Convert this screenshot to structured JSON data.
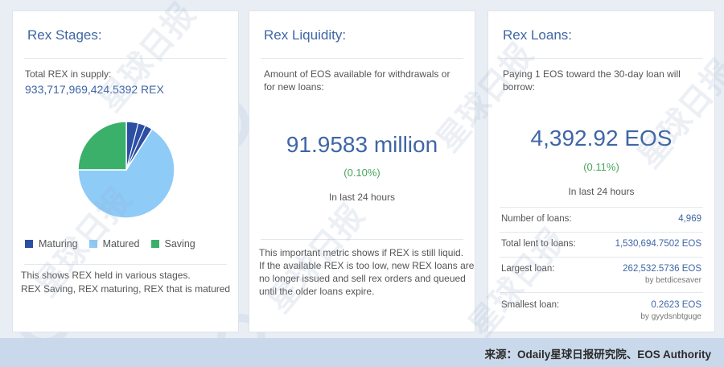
{
  "panels": {
    "stages": {
      "title": "Rex Stages:",
      "supply_label": "Total REX in supply:",
      "supply_value": "933,717,969,424.5392 REX",
      "legend": [
        {
          "label": "Maturing",
          "color": "#2d4fa3"
        },
        {
          "label": "Matured",
          "color": "#8ecbf7"
        },
        {
          "label": "Saving",
          "color": "#3ab06a"
        }
      ],
      "description_line1": "This shows REX held in various stages.",
      "description_line2": "REX Saving, REX maturing, REX that is matured"
    },
    "liquidity": {
      "title": "Rex Liquidity:",
      "description_line1": "Amount of EOS available for withdrawals or",
      "description_line2": "for new loans:",
      "amount": "91.9583 million",
      "change": "(0.10%)",
      "window": "In last 24 hours",
      "note_lines": [
        "This important metric shows if REX is still liquid.",
        "If the available REX is too low, new REX loans are",
        "no longer issued and sell rex orders and queued",
        "until the older loans expire."
      ]
    },
    "loans": {
      "title": "Rex Loans:",
      "description_line1": "Paying 1 EOS toward the 30-day loan will",
      "description_line2": "borrow:",
      "amount": "4,392.92 EOS",
      "change": "(0.11%)",
      "window": "In last 24 hours",
      "stats": {
        "number": {
          "label": "Number of loans:",
          "value": "4,969"
        },
        "total": {
          "label": "Total lent to loans:",
          "value": "1,530,694.7502 EOS"
        },
        "largest": {
          "label": "Largest loan:",
          "value": "262,532.5736 EOS",
          "sub": "by betdicesaver"
        },
        "smallest": {
          "label": "Smallest loan:",
          "value": "0.2623 EOS",
          "sub": "by gyydsnbtguge"
        }
      }
    }
  },
  "footer": {
    "source": "来源：Odaily星球日报研究院、EOS Authority"
  },
  "watermark": {
    "text": "星球日报",
    "latin": "ODAILY"
  },
  "chart_data": {
    "type": "pie",
    "categories": [
      "Maturing",
      "Matured",
      "Saving"
    ],
    "values": [
      9,
      66,
      25
    ],
    "colors": [
      "#2d4fa3",
      "#8ecbf7",
      "#3ab06a"
    ]
  }
}
